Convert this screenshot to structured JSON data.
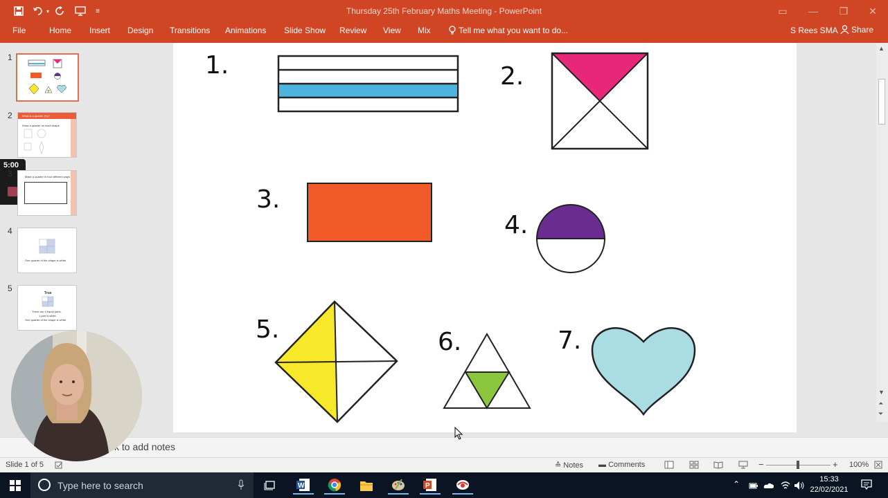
{
  "window": {
    "title": "Thursday 25th February Maths Meeting - PowerPoint",
    "qat_more": "≡"
  },
  "ribbon": {
    "tabs": [
      "File",
      "Home",
      "Insert",
      "Design",
      "Transitions",
      "Animations",
      "Slide Show",
      "Review",
      "View",
      "Mix"
    ],
    "tell_me": "Tell me what you want to do...",
    "user": "S Rees SMA",
    "share": "Share"
  },
  "thumbnails": [
    {
      "num": "1"
    },
    {
      "num": "2",
      "header": "What is a quarter (¼)?",
      "line": "Draw a quarter on each shape"
    },
    {
      "num": "3",
      "line": "Make a quarter in four different ways"
    },
    {
      "num": "4",
      "caption": "One quarter of the shape is white."
    },
    {
      "num": "5",
      "title": "True",
      "lines": [
        "There are 4 equal parts.",
        "1 part is white.",
        "One quarter of the shape is white."
      ]
    }
  ],
  "timer": {
    "value": "5:00"
  },
  "slide": {
    "numbers": [
      "1.",
      "2.",
      "3.",
      "4.",
      "5.",
      "6.",
      "7."
    ]
  },
  "notes": {
    "placeholder": "k to add notes"
  },
  "status": {
    "slide_info": "Slide 1 of 5",
    "notes": "Notes",
    "comments": "Comments",
    "zoom": "100%"
  },
  "taskbar": {
    "search_placeholder": "Type here to search",
    "time": "15:33",
    "date": "22/02/2021"
  },
  "colors": {
    "accent": "#d04523",
    "blue_stripe": "#4fb3df",
    "pink": "#e8277a",
    "orange": "#f05a28",
    "purple": "#6b2c91",
    "yellow": "#f7e82a",
    "green": "#8cc63f",
    "heart": "#aadde3"
  }
}
